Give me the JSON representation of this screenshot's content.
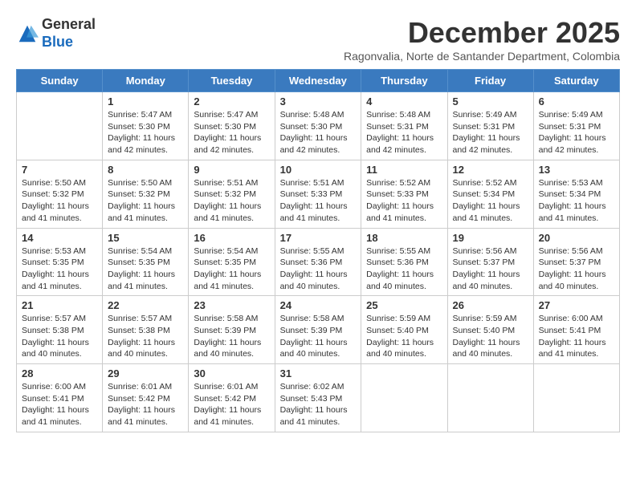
{
  "logo": {
    "general": "General",
    "blue": "Blue"
  },
  "title": "December 2025",
  "subtitle": "Ragonvalia, Norte de Santander Department, Colombia",
  "days_header": [
    "Sunday",
    "Monday",
    "Tuesday",
    "Wednesday",
    "Thursday",
    "Friday",
    "Saturday"
  ],
  "weeks": [
    [
      {
        "day": "",
        "info": ""
      },
      {
        "day": "1",
        "info": "Sunrise: 5:47 AM\nSunset: 5:30 PM\nDaylight: 11 hours\nand 42 minutes."
      },
      {
        "day": "2",
        "info": "Sunrise: 5:47 AM\nSunset: 5:30 PM\nDaylight: 11 hours\nand 42 minutes."
      },
      {
        "day": "3",
        "info": "Sunrise: 5:48 AM\nSunset: 5:30 PM\nDaylight: 11 hours\nand 42 minutes."
      },
      {
        "day": "4",
        "info": "Sunrise: 5:48 AM\nSunset: 5:31 PM\nDaylight: 11 hours\nand 42 minutes."
      },
      {
        "day": "5",
        "info": "Sunrise: 5:49 AM\nSunset: 5:31 PM\nDaylight: 11 hours\nand 42 minutes."
      },
      {
        "day": "6",
        "info": "Sunrise: 5:49 AM\nSunset: 5:31 PM\nDaylight: 11 hours\nand 42 minutes."
      }
    ],
    [
      {
        "day": "7",
        "info": "Sunrise: 5:50 AM\nSunset: 5:32 PM\nDaylight: 11 hours\nand 41 minutes."
      },
      {
        "day": "8",
        "info": "Sunrise: 5:50 AM\nSunset: 5:32 PM\nDaylight: 11 hours\nand 41 minutes."
      },
      {
        "day": "9",
        "info": "Sunrise: 5:51 AM\nSunset: 5:32 PM\nDaylight: 11 hours\nand 41 minutes."
      },
      {
        "day": "10",
        "info": "Sunrise: 5:51 AM\nSunset: 5:33 PM\nDaylight: 11 hours\nand 41 minutes."
      },
      {
        "day": "11",
        "info": "Sunrise: 5:52 AM\nSunset: 5:33 PM\nDaylight: 11 hours\nand 41 minutes."
      },
      {
        "day": "12",
        "info": "Sunrise: 5:52 AM\nSunset: 5:34 PM\nDaylight: 11 hours\nand 41 minutes."
      },
      {
        "day": "13",
        "info": "Sunrise: 5:53 AM\nSunset: 5:34 PM\nDaylight: 11 hours\nand 41 minutes."
      }
    ],
    [
      {
        "day": "14",
        "info": "Sunrise: 5:53 AM\nSunset: 5:35 PM\nDaylight: 11 hours\nand 41 minutes."
      },
      {
        "day": "15",
        "info": "Sunrise: 5:54 AM\nSunset: 5:35 PM\nDaylight: 11 hours\nand 41 minutes."
      },
      {
        "day": "16",
        "info": "Sunrise: 5:54 AM\nSunset: 5:35 PM\nDaylight: 11 hours\nand 41 minutes."
      },
      {
        "day": "17",
        "info": "Sunrise: 5:55 AM\nSunset: 5:36 PM\nDaylight: 11 hours\nand 40 minutes."
      },
      {
        "day": "18",
        "info": "Sunrise: 5:55 AM\nSunset: 5:36 PM\nDaylight: 11 hours\nand 40 minutes."
      },
      {
        "day": "19",
        "info": "Sunrise: 5:56 AM\nSunset: 5:37 PM\nDaylight: 11 hours\nand 40 minutes."
      },
      {
        "day": "20",
        "info": "Sunrise: 5:56 AM\nSunset: 5:37 PM\nDaylight: 11 hours\nand 40 minutes."
      }
    ],
    [
      {
        "day": "21",
        "info": "Sunrise: 5:57 AM\nSunset: 5:38 PM\nDaylight: 11 hours\nand 40 minutes."
      },
      {
        "day": "22",
        "info": "Sunrise: 5:57 AM\nSunset: 5:38 PM\nDaylight: 11 hours\nand 40 minutes."
      },
      {
        "day": "23",
        "info": "Sunrise: 5:58 AM\nSunset: 5:39 PM\nDaylight: 11 hours\nand 40 minutes."
      },
      {
        "day": "24",
        "info": "Sunrise: 5:58 AM\nSunset: 5:39 PM\nDaylight: 11 hours\nand 40 minutes."
      },
      {
        "day": "25",
        "info": "Sunrise: 5:59 AM\nSunset: 5:40 PM\nDaylight: 11 hours\nand 40 minutes."
      },
      {
        "day": "26",
        "info": "Sunrise: 5:59 AM\nSunset: 5:40 PM\nDaylight: 11 hours\nand 40 minutes."
      },
      {
        "day": "27",
        "info": "Sunrise: 6:00 AM\nSunset: 5:41 PM\nDaylight: 11 hours\nand 41 minutes."
      }
    ],
    [
      {
        "day": "28",
        "info": "Sunrise: 6:00 AM\nSunset: 5:41 PM\nDaylight: 11 hours\nand 41 minutes."
      },
      {
        "day": "29",
        "info": "Sunrise: 6:01 AM\nSunset: 5:42 PM\nDaylight: 11 hours\nand 41 minutes."
      },
      {
        "day": "30",
        "info": "Sunrise: 6:01 AM\nSunset: 5:42 PM\nDaylight: 11 hours\nand 41 minutes."
      },
      {
        "day": "31",
        "info": "Sunrise: 6:02 AM\nSunset: 5:43 PM\nDaylight: 11 hours\nand 41 minutes."
      },
      {
        "day": "",
        "info": ""
      },
      {
        "day": "",
        "info": ""
      },
      {
        "day": "",
        "info": ""
      }
    ]
  ]
}
